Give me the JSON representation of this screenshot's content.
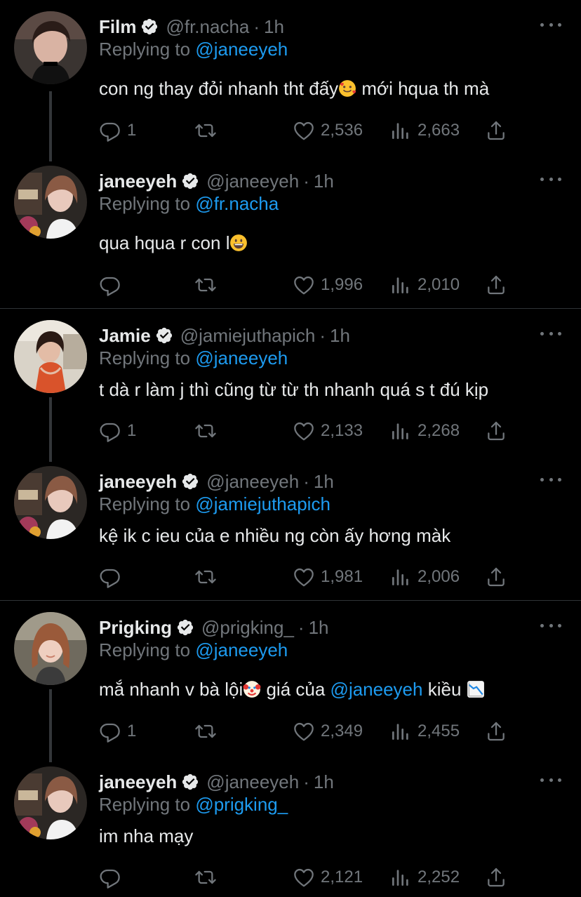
{
  "tweets": [
    {
      "name": "Film",
      "handle": "@fr.nacha",
      "time": "1h",
      "replying_prefix": "Replying to",
      "replying_to": "@janeeyeh",
      "text_before": "con ng thay đỏi nhanh tht đấy",
      "emoji": "smiling-face-with-hearts-emoji",
      "text_after": " mới hqua th mà",
      "replies": "1",
      "retweets": "",
      "likes": "2,536",
      "views": "2,663"
    },
    {
      "name": "janeeyeh",
      "handle": "@janeeyeh",
      "time": "1h",
      "replying_prefix": "Replying to",
      "replying_to": "@fr.nacha",
      "text_before": "qua hqua r con l",
      "emoji": "grinning-face-emoji",
      "text_after": "",
      "replies": "",
      "retweets": "",
      "likes": "1,996",
      "views": "2,010"
    },
    {
      "name": "Jamie",
      "handle": "@jamiejuthapich",
      "time": "1h",
      "replying_prefix": "Replying to",
      "replying_to": "@janeeyeh",
      "text_before": "t dà r làm j thì cũng từ từ th nhanh quá s t đú kịp",
      "text_after": "",
      "replies": "1",
      "retweets": "",
      "likes": "2,133",
      "views": "2,268"
    },
    {
      "name": "janeeyeh",
      "handle": "@janeeyeh",
      "time": "1h",
      "replying_prefix": "Replying to",
      "replying_to": "@jamiejuthapich",
      "text_before": "kệ ik c ieu của e nhiều ng còn ấy hơng màk",
      "text_after": "",
      "replies": "",
      "retweets": "",
      "likes": "1,981",
      "views": "2,006"
    },
    {
      "name": "Prigking",
      "handle": "@prigking_",
      "time": "1h",
      "replying_prefix": "Replying to",
      "replying_to": "@janeeyeh",
      "text_before": "mắ nhanh v bà lội",
      "emoji": "clown-face-emoji",
      "text_middle": " giá của ",
      "mention": "@janeeyeh",
      "text_after": " kiều ",
      "emoji2": "chart-decreasing-emoji",
      "replies": "1",
      "retweets": "",
      "likes": "2,349",
      "views": "2,455"
    },
    {
      "name": "janeeyeh",
      "handle": "@janeeyeh",
      "time": "1h",
      "replying_prefix": "Replying to",
      "replying_to": "@prigking_",
      "text_before": "im nha mạy",
      "text_after": "",
      "replies": "",
      "retweets": "",
      "likes": "2,121",
      "views": "2,252"
    }
  ],
  "separator": "·",
  "colors": {
    "background": "#000000",
    "text": "#e7e9ea",
    "muted": "#71767b",
    "accent": "#1d9bf0"
  },
  "icons": [
    "verified-badge-icon",
    "more-icon",
    "reply-icon",
    "retweet-icon",
    "like-icon",
    "views-icon",
    "share-icon"
  ]
}
